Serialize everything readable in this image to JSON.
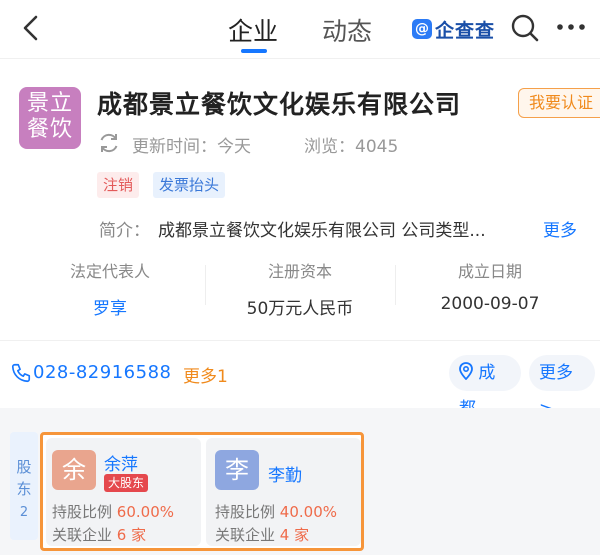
{
  "nav": {
    "tabs": [
      "企业",
      "动态"
    ],
    "active_tab": 0,
    "brand": "企查查"
  },
  "company": {
    "logo_text": [
      "景立",
      "餐饮"
    ],
    "name": "成都景立餐饮文化娱乐有限公司",
    "verify_button": "我要认证",
    "update_label": "更新时间：今天",
    "views_label": "浏览：4045",
    "tags": [
      "注销",
      "发票抬头"
    ],
    "intro_label": "简介：",
    "intro_text": "成都景立餐饮文化娱乐有限公司 公司类型...",
    "intro_more": "更多"
  },
  "info": [
    {
      "label": "法定代表人",
      "value": "罗享"
    },
    {
      "label": "注册资本",
      "value": "50万元人民币"
    },
    {
      "label": "成立日期",
      "value": "2000-09-07"
    }
  ],
  "contact": {
    "phone": "028-82916588",
    "phone_more": "更多1",
    "city": "成都",
    "more": "更多>"
  },
  "shareholders": {
    "side_label": [
      "股",
      "东"
    ],
    "count": "2",
    "items": [
      {
        "avatar": "余",
        "name": "余萍",
        "badge": "大股东",
        "ratio_label": "持股比例",
        "ratio": "60.00%",
        "related_label": "关联企业",
        "related": "6 家",
        "color": "#e9a58e"
      },
      {
        "avatar": "李",
        "name": "李勤",
        "ratio_label": "持股比例",
        "ratio": "40.00%",
        "related_label": "关联企业",
        "related": "4 家",
        "color": "#8ea7e0"
      }
    ]
  },
  "colors": {
    "accent": "#1677ff",
    "highlight": "#f6953a"
  }
}
